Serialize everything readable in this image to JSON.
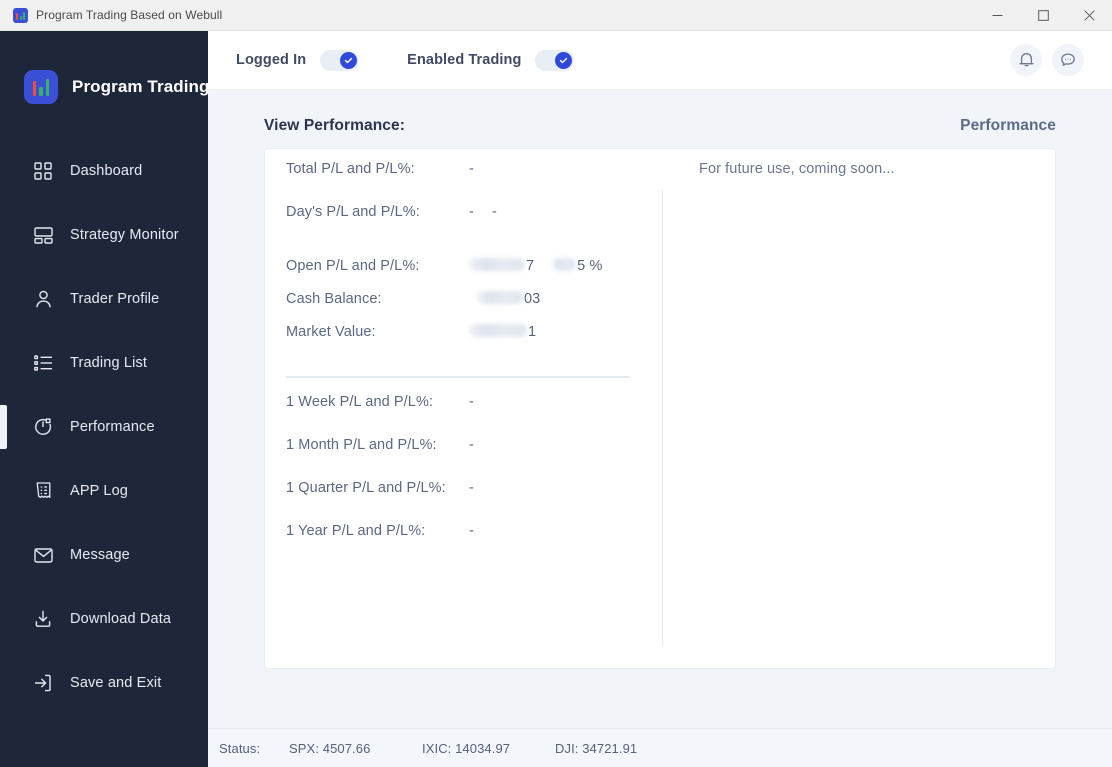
{
  "window": {
    "title": "Program Trading Based on Webull",
    "controls": {
      "minimize": "minimize-button",
      "maximize": "maximize-button",
      "close": "close-button"
    }
  },
  "sidebar": {
    "brand": "Program Trading",
    "items": [
      {
        "label": "Dashboard",
        "icon": "grid-icon",
        "active": false
      },
      {
        "label": "Strategy Monitor",
        "icon": "layout-icon",
        "active": false
      },
      {
        "label": "Trader Profile",
        "icon": "user-icon",
        "active": false
      },
      {
        "label": "Trading List",
        "icon": "list-icon",
        "active": false
      },
      {
        "label": "Performance",
        "icon": "pie-chart-icon",
        "active": true
      },
      {
        "label": "APP Log",
        "icon": "receipt-icon",
        "active": false
      },
      {
        "label": "Message",
        "icon": "envelope-icon",
        "active": false
      },
      {
        "label": "Download Data",
        "icon": "download-icon",
        "active": false
      },
      {
        "label": "Save and Exit",
        "icon": "exit-icon",
        "active": false
      }
    ]
  },
  "topbar": {
    "logged_in_label": "Logged In",
    "logged_in_state": "on",
    "enabled_trading_label": "Enabled Trading",
    "enabled_trading_state": "on",
    "notification_icon": "bell-icon",
    "chat_icon": "chat-bubble-icon"
  },
  "main": {
    "title": "View Performance:",
    "subtitle": "Performance",
    "right_panel_text": "For future use, coming soon...",
    "metrics_primary": [
      {
        "label": "Total P/L and P/L%:",
        "value": "-",
        "value2": "",
        "redacted": false
      },
      {
        "label": "Day's P/L and P/L%:",
        "value": "-",
        "value2": "-",
        "redacted": false
      },
      {
        "label": "Open P/L and P/L%:",
        "value": "7",
        "value2": "5 %",
        "redacted": true
      },
      {
        "label": "Cash Balance:",
        "value": "03",
        "value2": "",
        "redacted": true
      },
      {
        "label": "Market Value:",
        "value": "1",
        "value2": "",
        "redacted": true
      }
    ],
    "metrics_period": [
      {
        "label": "1 Week P/L and P/L%:",
        "value": "-"
      },
      {
        "label": "1 Month P/L and P/L%:",
        "value": "-"
      },
      {
        "label": "1 Quarter P/L and P/L%:",
        "value": "-"
      },
      {
        "label": "1 Year P/L and P/L%:",
        "value": "-"
      }
    ]
  },
  "statusbar": {
    "label": "Status:",
    "indices": [
      "SPX: 4507.66",
      "IXIC: 14034.97",
      "DJI: 34721.91"
    ]
  },
  "colors": {
    "sidebar_bg": "#1e2639",
    "accent": "#2f4adb",
    "content_bg": "#f1f4f9",
    "text_muted": "#5b6883"
  }
}
